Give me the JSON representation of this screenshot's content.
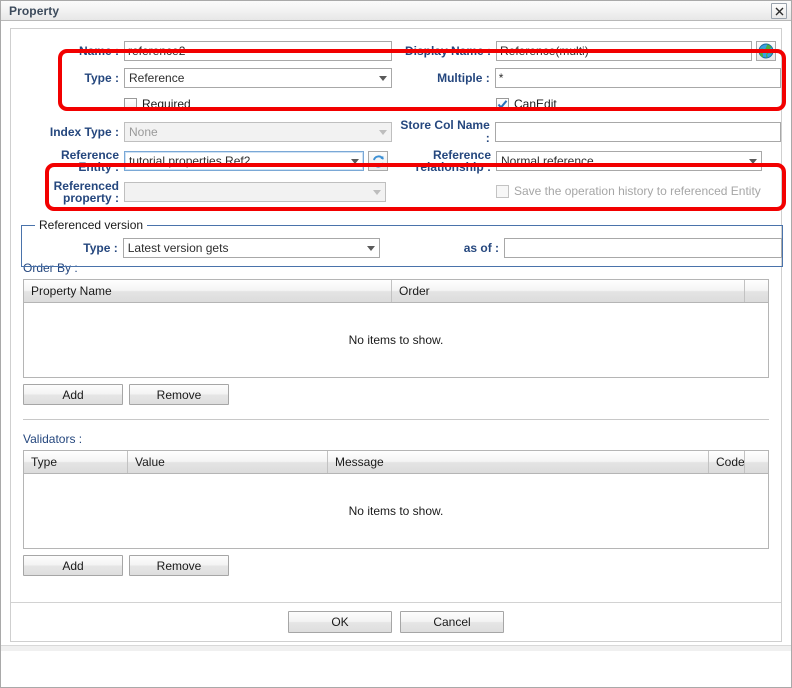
{
  "window": {
    "title": "Property",
    "close_icon": "close-icon"
  },
  "form": {
    "name": {
      "label": "Name :",
      "value": "reference2"
    },
    "display_name": {
      "label": "Display Name :",
      "value": "Reference(multi)",
      "globe_icon": "globe-icon"
    },
    "type": {
      "label": "Type :",
      "value": "Reference"
    },
    "multiple": {
      "label": "Multiple :",
      "value": "*"
    },
    "required": {
      "label": "Required",
      "checked": false
    },
    "can_edit": {
      "label": "CanEdit",
      "checked": true
    },
    "index_type": {
      "label": "Index Type :",
      "value": "None",
      "disabled": true
    },
    "store_col_name": {
      "label": "Store Col Name :",
      "value": ""
    },
    "reference_entity": {
      "label": "Reference Entity :",
      "label_line1": "Reference",
      "label_line2": "Entity :",
      "value": "tutorial.properties.Ref2",
      "refresh_icon": "refresh-icon"
    },
    "reference_relationship": {
      "label_line1": "Reference",
      "label_line2": "relationship :",
      "value": "Normal reference"
    },
    "referenced_property": {
      "label_line1": "Referenced",
      "label_line2": "property :",
      "value": "",
      "disabled": true
    },
    "save_history": {
      "label": "Save the operation history to referenced Entity",
      "checked": false,
      "disabled": true
    },
    "referenced_version": {
      "legend": "Referenced version",
      "type": {
        "label": "Type :",
        "value": "Latest version gets"
      },
      "as_of": {
        "label": "as of :",
        "value": ""
      }
    }
  },
  "order_by": {
    "label": "Order By :",
    "columns": [
      "Property Name",
      "Order",
      ""
    ],
    "rows": [],
    "empty_text": "No items to show.",
    "add_label": "Add",
    "remove_label": "Remove"
  },
  "validators": {
    "label": "Validators :",
    "columns": [
      "Type",
      "Value",
      "Message",
      "Code",
      ""
    ],
    "rows": [],
    "empty_text": "No items to show.",
    "add_label": "Add",
    "remove_label": "Remove"
  },
  "footer": {
    "ok_label": "OK",
    "cancel_label": "Cancel"
  },
  "highlights": {
    "top_annotation_color": "#f20000",
    "middle_annotation_color": "#f20000"
  }
}
